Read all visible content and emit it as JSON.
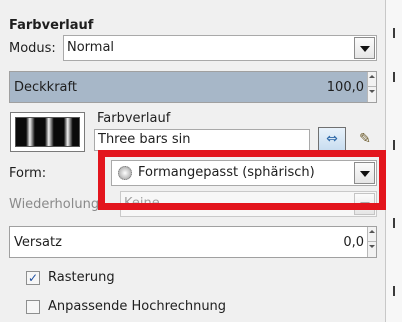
{
  "panel": {
    "title": "Farbverlauf",
    "mode_label": "Modus:",
    "mode_value": "Normal",
    "opacity_label": "Deckkraft",
    "opacity_value": "100,0",
    "gradient_label": "Farbverlauf",
    "gradient_name": "Three bars sin",
    "shape_label": "Form:",
    "shape_value": "Formangepasst (sphärisch)",
    "repeat_label": "Wiederholung:",
    "repeat_value": "Keine",
    "offset_label": "Versatz",
    "offset_value": "0,0",
    "dithering_label": "Rasterung",
    "dithering_checked": true,
    "supersampling_label": "Anpassende Hochrechnung",
    "supersampling_checked": false
  },
  "colors": {
    "highlight": "#e3151d",
    "slider_fill": "#a7b7c8"
  }
}
